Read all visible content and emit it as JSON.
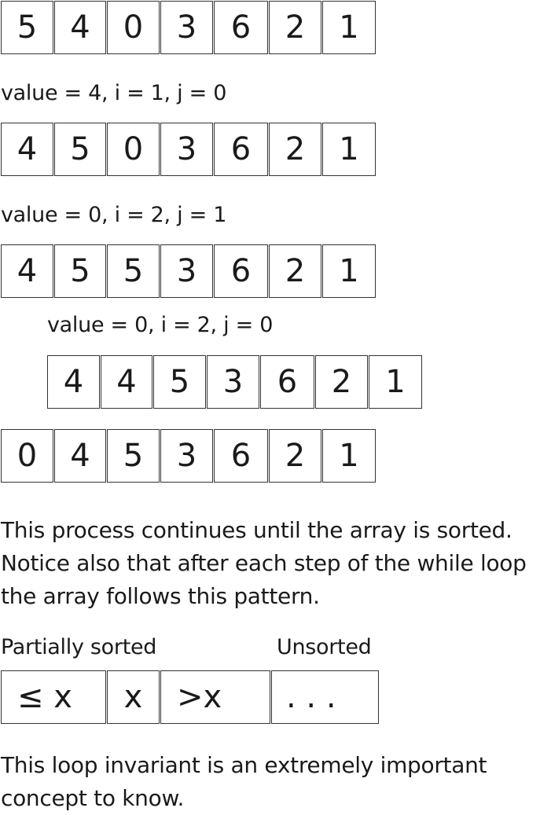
{
  "steps": [
    {
      "cells": [
        "5",
        "4",
        "0",
        "3",
        "6",
        "2",
        "1"
      ]
    },
    {
      "label": "value = 4, i = 1, j = 0",
      "cells": [
        "4",
        "5",
        "0",
        "3",
        "6",
        "2",
        "1"
      ]
    },
    {
      "label": "value = 0, i = 2, j = 1",
      "cells": [
        "4",
        "5",
        "5",
        "3",
        "6",
        "2",
        "1"
      ]
    },
    {
      "label": "value = 0, i = 2, j = 0",
      "cells": [
        "4",
        "4",
        "5",
        "3",
        "6",
        "2",
        "1"
      ]
    },
    {
      "cells": [
        "0",
        "4",
        "5",
        "3",
        "6",
        "2",
        "1"
      ]
    }
  ],
  "paragraph1": [
    "This process continues until the array is sorted.",
    "Notice also that after each step of the while loop",
    "the array follows this pattern."
  ],
  "pattern": {
    "partial_label": "Partially sorted",
    "unsorted_label": "Unsorted",
    "cells": [
      "≤ x",
      "x",
      ">x",
      ". . ."
    ]
  },
  "paragraph2": [
    "This loop invariant is an extremely important",
    "concept to know."
  ]
}
